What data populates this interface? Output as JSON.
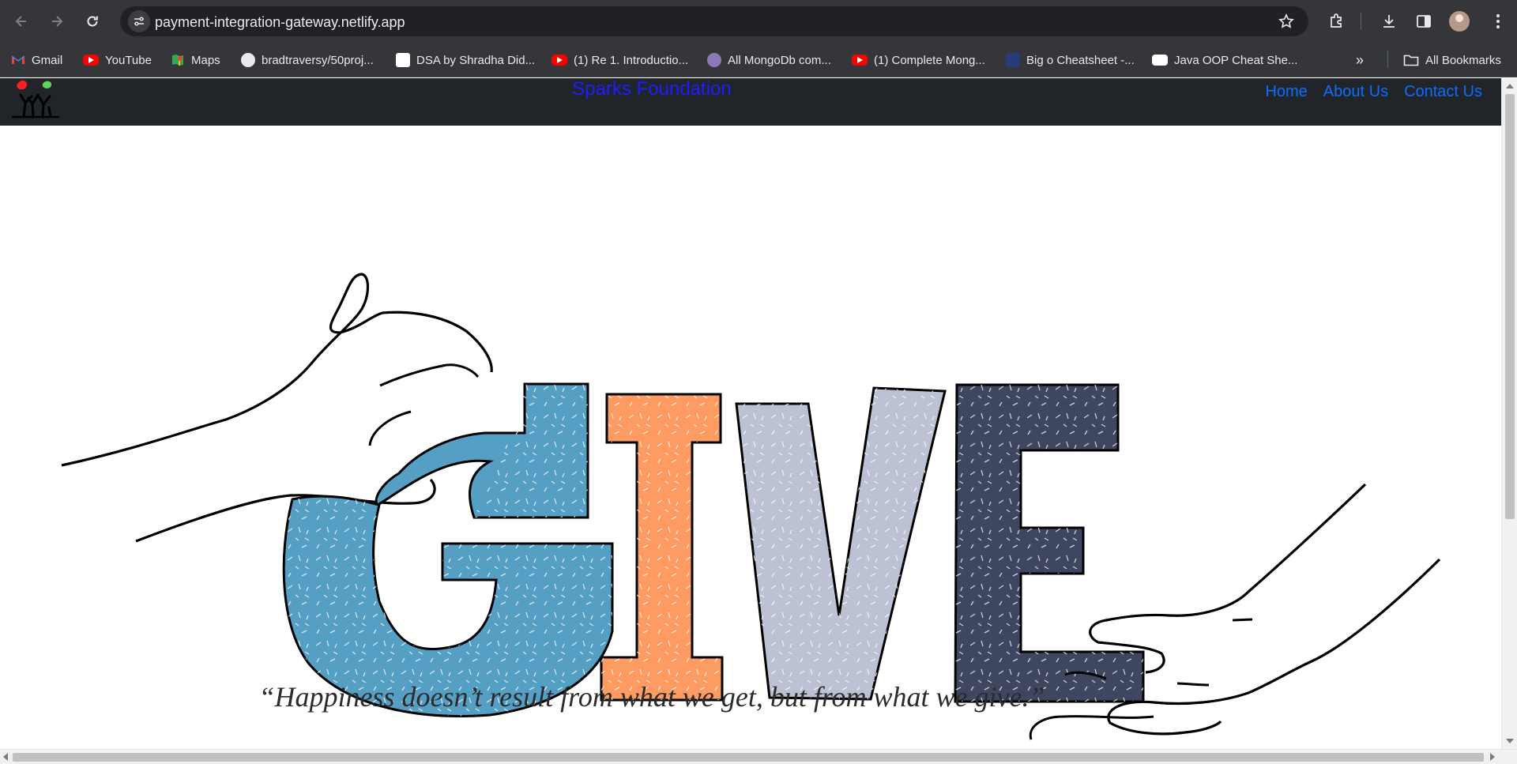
{
  "browser": {
    "url": "payment-integration-gateway.netlify.app",
    "bookmarks": [
      {
        "label": "Gmail",
        "icon": "gmail-icon"
      },
      {
        "label": "YouTube",
        "icon": "youtube-icon"
      },
      {
        "label": "Maps",
        "icon": "maps-icon"
      },
      {
        "label": "bradtraversy/50proj...",
        "icon": "github-icon"
      },
      {
        "label": "DSA by Shradha Did...",
        "icon": "dsa-icon"
      },
      {
        "label": "(1) Re 1. Introductio...",
        "icon": "youtube-icon"
      },
      {
        "label": "All MongoDb com...",
        "icon": "avatar-icon"
      },
      {
        "label": "(1) Complete Mong...",
        "icon": "youtube-icon"
      },
      {
        "label": "Big o Cheatsheet -...",
        "icon": "bigo-icon"
      },
      {
        "label": "Java OOP Cheat She...",
        "icon": "medium-icon"
      }
    ],
    "more_label": "»",
    "all_bookmarks_label": "All Bookmarks"
  },
  "site": {
    "brand": "Sparks Foundation",
    "nav": [
      "Home",
      "About Us",
      "Contact Us"
    ],
    "hero_letters": [
      "G",
      "I",
      "V",
      "E"
    ],
    "hero_colors": {
      "g": "#569fc4",
      "i": "#fe9b62",
      "v": "#bcc2d4",
      "e": "#3f4660"
    },
    "quote": "“Happiness doesn’t result from what we get, but from what we give.”"
  },
  "colors": {
    "toolbar": "#35363a",
    "omnibox": "#202124",
    "site_nav": "#212529",
    "brand": "#1d1dff",
    "link": "#0d6efd"
  }
}
